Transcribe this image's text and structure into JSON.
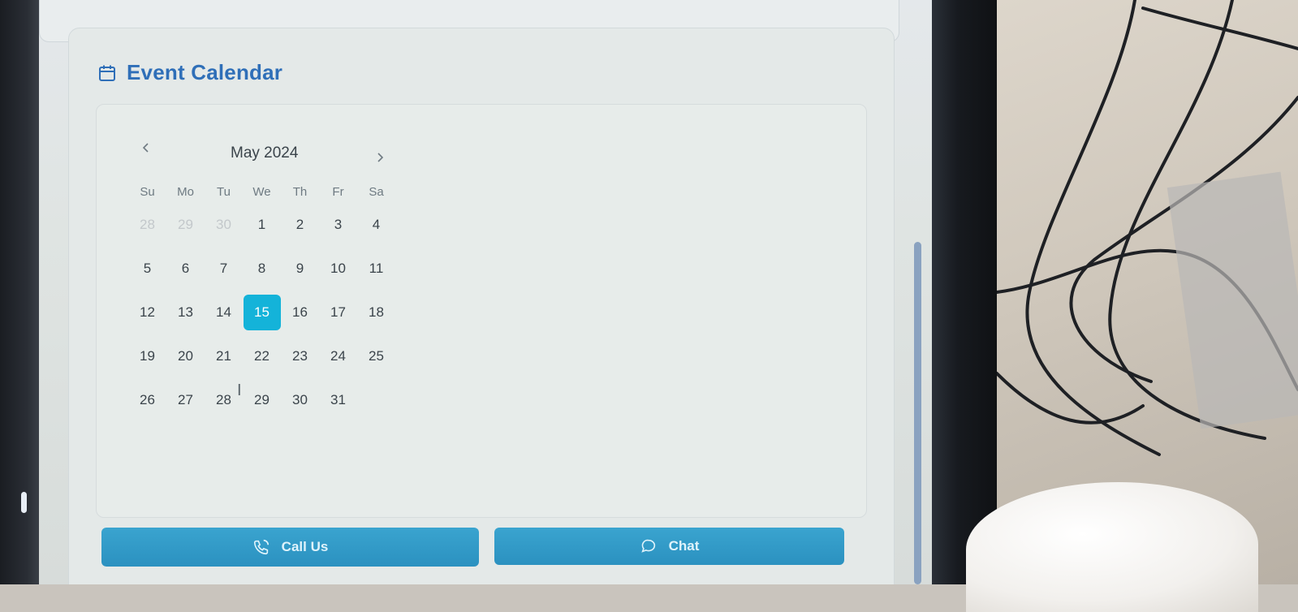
{
  "section": {
    "title": "Event Calendar",
    "icon": "calendar-icon"
  },
  "calendar": {
    "month_label": "May 2024",
    "prev_icon": "chevron-left-icon",
    "next_icon": "chevron-right-icon",
    "weekdays": [
      "Su",
      "Mo",
      "Tu",
      "We",
      "Th",
      "Fr",
      "Sa"
    ],
    "weeks": [
      [
        "28",
        "29",
        "30",
        "1",
        "2",
        "3",
        "4"
      ],
      [
        "5",
        "6",
        "7",
        "8",
        "9",
        "10",
        "11"
      ],
      [
        "12",
        "13",
        "14",
        "15",
        "16",
        "17",
        "18"
      ],
      [
        "19",
        "20",
        "21",
        "22",
        "23",
        "24",
        "25"
      ],
      [
        "26",
        "27",
        "28",
        "29",
        "30",
        "31",
        ""
      ]
    ],
    "outside_month": [
      [
        0,
        0
      ],
      [
        0,
        1
      ],
      [
        0,
        2
      ]
    ],
    "selected_day": "15",
    "selected_color": "#14b3d9"
  },
  "actions": {
    "call_label": "Call Us",
    "call_icon": "phone-icon",
    "chat_label": "Chat",
    "chat_icon": "chat-bubble-icon",
    "button_color": "#2b91c0"
  }
}
